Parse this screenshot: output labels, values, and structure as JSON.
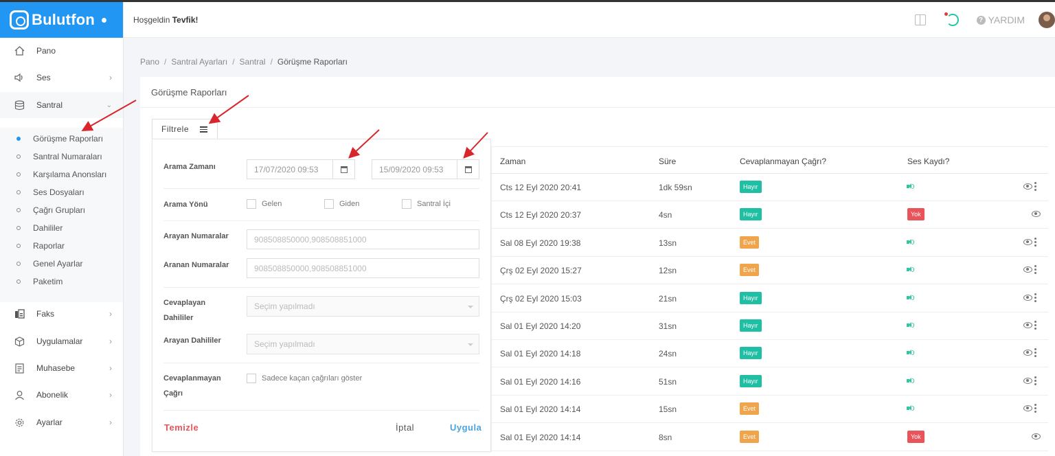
{
  "brand": {
    "name": "Bulutfon"
  },
  "header": {
    "welcome_prefix": "Hoşgeldin",
    "user_name": "Tevfik!",
    "help_label": "YARDIM"
  },
  "sidebar": {
    "items": [
      {
        "label": "Pano",
        "icon": "home-icon"
      },
      {
        "label": "Ses",
        "icon": "speaker-icon"
      },
      {
        "label": "Santral",
        "icon": "database-icon"
      },
      {
        "label": "Faks",
        "icon": "fax-icon"
      },
      {
        "label": "Uygulamalar",
        "icon": "cube-icon"
      },
      {
        "label": "Muhasebe",
        "icon": "receipt-icon"
      },
      {
        "label": "Abonelik",
        "icon": "user-icon"
      },
      {
        "label": "Ayarlar",
        "icon": "gear-icon"
      }
    ],
    "santral_sub": [
      "Görüşme Raporları",
      "Santral Numaraları",
      "Karşılama Anonsları",
      "Ses Dosyaları",
      "Çağrı Grupları",
      "Dahililer",
      "Raporlar",
      "Genel Ayarlar",
      "Paketim"
    ]
  },
  "breadcrumb": {
    "items": [
      "Pano",
      "Santral Ayarları",
      "Santral"
    ],
    "current": "Görüşme Raporları"
  },
  "page": {
    "title": "Görüşme Raporları"
  },
  "filter": {
    "button_label": "Filtrele",
    "call_time_label": "Arama Zamanı",
    "date_from": "17/07/2020 09:53",
    "date_to": "15/09/2020 09:53",
    "direction_label": "Arama Yönü",
    "direction_options": [
      "Gelen",
      "Giden",
      "Santral İçi"
    ],
    "callers_label": "Arayan Numaralar",
    "callers_placeholder": "908508850000,908508851000",
    "called_label": "Aranan Numaralar",
    "called_placeholder": "908508850000,908508851000",
    "answering_ext_label_1": "Cevaplayan",
    "answering_ext_label_2": "Dahililer",
    "answering_ext_value": "Seçim yapılmadı",
    "caller_ext_label": "Arayan Dahililer",
    "caller_ext_value": "Seçim yapılmadı",
    "missed_label_1": "Cevaplanmayan",
    "missed_label_2": "Çağrı",
    "missed_option": "Sadece kaçan çağrıları göster",
    "clear_label": "Temizle",
    "cancel_label": "İptal",
    "apply_label": "Uygula",
    "colors": {
      "clear": "#e8545a",
      "apply": "#4aa3df"
    }
  },
  "table": {
    "headers": [
      "Zaman",
      "Süre",
      "Cevaplanmayan Çağrı?",
      "Ses Kaydı?"
    ],
    "rows": [
      {
        "time": "Cts 12 Eyl 2020 20:41",
        "duration": "1dk 59sn",
        "missed": "Hayır",
        "recording": "audio"
      },
      {
        "time": "Cts 12 Eyl 2020 20:37",
        "duration": "4sn",
        "missed": "Hayır",
        "recording": "Yok"
      },
      {
        "time": "Sal 08 Eyl 2020 19:38",
        "duration": "13sn",
        "missed": "Evet",
        "recording": "audio"
      },
      {
        "time": "Çrş 02 Eyl 2020 15:27",
        "duration": "12sn",
        "missed": "Evet",
        "recording": "audio"
      },
      {
        "time": "Çrş 02 Eyl 2020 15:03",
        "duration": "21sn",
        "missed": "Hayır",
        "recording": "audio"
      },
      {
        "time": "Sal 01 Eyl 2020 14:20",
        "duration": "31sn",
        "missed": "Hayır",
        "recording": "audio"
      },
      {
        "time": "Sal 01 Eyl 2020 14:18",
        "duration": "24sn",
        "missed": "Hayır",
        "recording": "audio"
      },
      {
        "time": "Sal 01 Eyl 2020 14:16",
        "duration": "51sn",
        "missed": "Hayır",
        "recording": "audio"
      },
      {
        "time": "Sal 01 Eyl 2020 14:14",
        "duration": "15sn",
        "missed": "Evet",
        "recording": "audio"
      },
      {
        "time": "Sal 01 Eyl 2020 14:14",
        "duration": "8sn",
        "missed": "Evet",
        "recording": "Yok"
      }
    ]
  },
  "colors": {
    "brand": "#2196f3",
    "hayir": "#1fbfa3",
    "evet": "#f0a44b",
    "yok": "#e8545a",
    "annotation_arrow": "#d9262c"
  }
}
